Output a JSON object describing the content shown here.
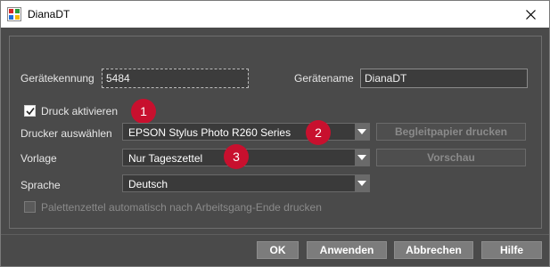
{
  "window": {
    "title": "DianaDT",
    "icon": "app-icon",
    "close_icon": "close-icon"
  },
  "fields": {
    "device_id": {
      "label": "Gerätekennung",
      "value": "5484"
    },
    "device_name": {
      "label": "Gerätename",
      "value": "DianaDT"
    }
  },
  "print_enable": {
    "label": "Druck aktivieren",
    "checked": true
  },
  "printer": {
    "label": "Drucker auswählen",
    "value": "EPSON Stylus Photo R260 Series"
  },
  "template": {
    "label": "Vorlage",
    "value": "Nur Tageszettel"
  },
  "language": {
    "label": "Sprache",
    "value": "Deutsch"
  },
  "side_buttons": {
    "cover_print": "Begleitpapier drucken",
    "preview": "Vorschau"
  },
  "auto_pallet": {
    "label": "Palettenzettel automatisch nach Arbeitsgang-Ende drucken",
    "checked": false,
    "enabled": false
  },
  "badges": [
    "1",
    "2",
    "3"
  ],
  "buttons": {
    "ok": "OK",
    "apply": "Anwenden",
    "cancel": "Abbrechen",
    "help": "Hilfe"
  },
  "colors": {
    "badge": "#c8102e",
    "dialog_bg": "#4a4a4a"
  }
}
